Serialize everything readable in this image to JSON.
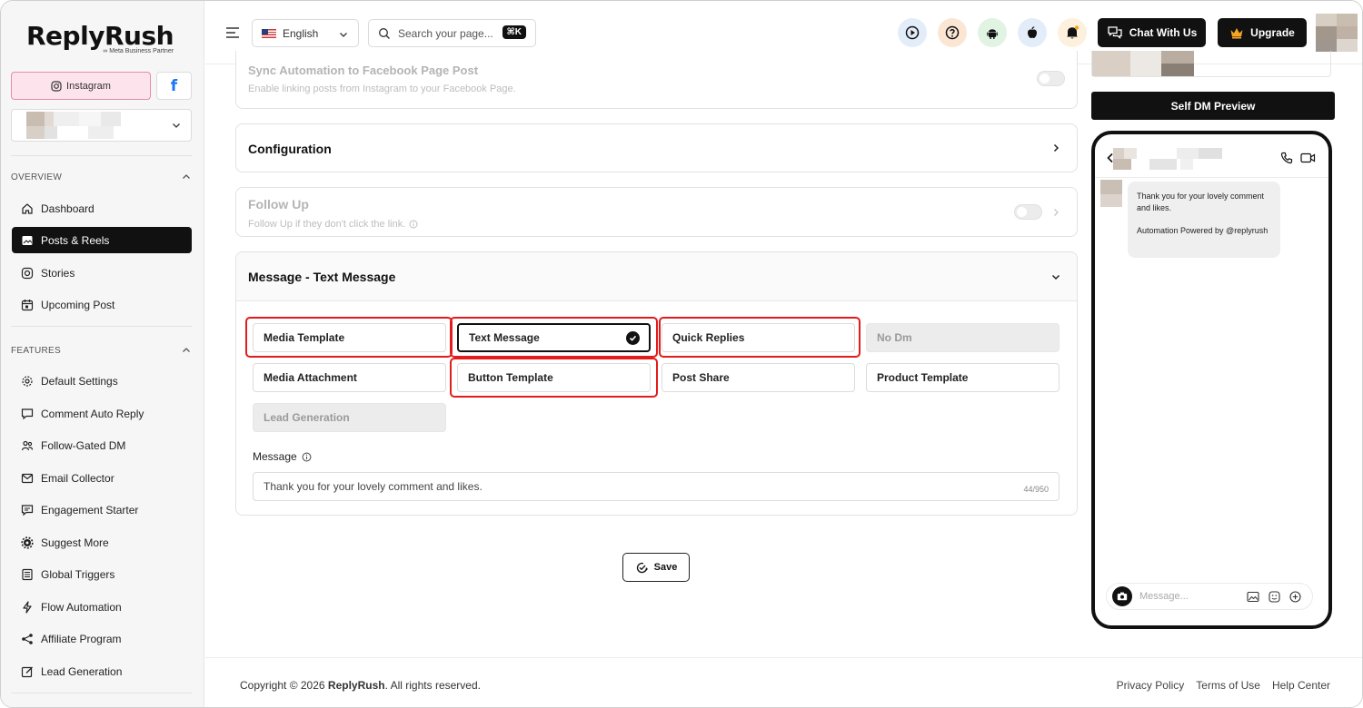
{
  "brand": {
    "name": "ReplyRush",
    "partner": "∞ Meta Business Partner"
  },
  "account_tabs": {
    "instagram": "Instagram",
    "facebook": "f"
  },
  "sidebar": {
    "overview_label": "OVERVIEW",
    "overview_items": [
      "Dashboard",
      "Posts & Reels",
      "Stories",
      "Upcoming Post"
    ],
    "features_label": "FEATURES",
    "feature_items": [
      "Default Settings",
      "Comment Auto Reply",
      "Follow-Gated DM",
      "Email Collector",
      "Engagement Starter",
      "Suggest More",
      "Global Triggers",
      "Flow Automation",
      "Affiliate Program",
      "Lead Generation"
    ]
  },
  "topbar": {
    "language": "English",
    "search_placeholder": "Search your page...",
    "search_shortcut": "⌘K",
    "chat_label": "Chat With Us",
    "upgrade_label": "Upgrade"
  },
  "sync_card": {
    "title": "Sync Automation to Facebook Page Post",
    "subtitle": "Enable linking posts from Instagram to your Facebook Page."
  },
  "configuration_card": {
    "title": "Configuration"
  },
  "follow_up_card": {
    "title": "Follow Up",
    "subtitle": "Follow Up if they don't click the link."
  },
  "message_card": {
    "title": "Message - Text Message",
    "options": [
      "Media Template",
      "Text Message",
      "Quick Replies",
      "No Dm",
      "Media Attachment",
      "Button Template",
      "Post Share",
      "Product Template",
      "Lead Generation"
    ],
    "selected": "Text Message",
    "message_label": "Message",
    "message_value": "Thank you for your lovely comment and likes.",
    "char_count": "44/950"
  },
  "save_label": "Save",
  "footer": {
    "copyright_prefix": "Copyright © 2026 ",
    "copyright_brand": "ReplyRush",
    "copyright_suffix": ". All rights reserved.",
    "links": [
      "Privacy Policy",
      "Terms of Use",
      "Help Center"
    ]
  },
  "preview": {
    "button_label": "Self DM Preview",
    "bubble_line1": "Thank you for your lovely comment and likes.",
    "bubble_line2": "Automation Powered by @replyrush",
    "compose_placeholder": "Message..."
  },
  "colors": {
    "accent_dark": "#111111",
    "highlight_red": "#e21b1b",
    "instagram_pink": "#fde4ec",
    "facebook_blue": "#1877f2"
  }
}
